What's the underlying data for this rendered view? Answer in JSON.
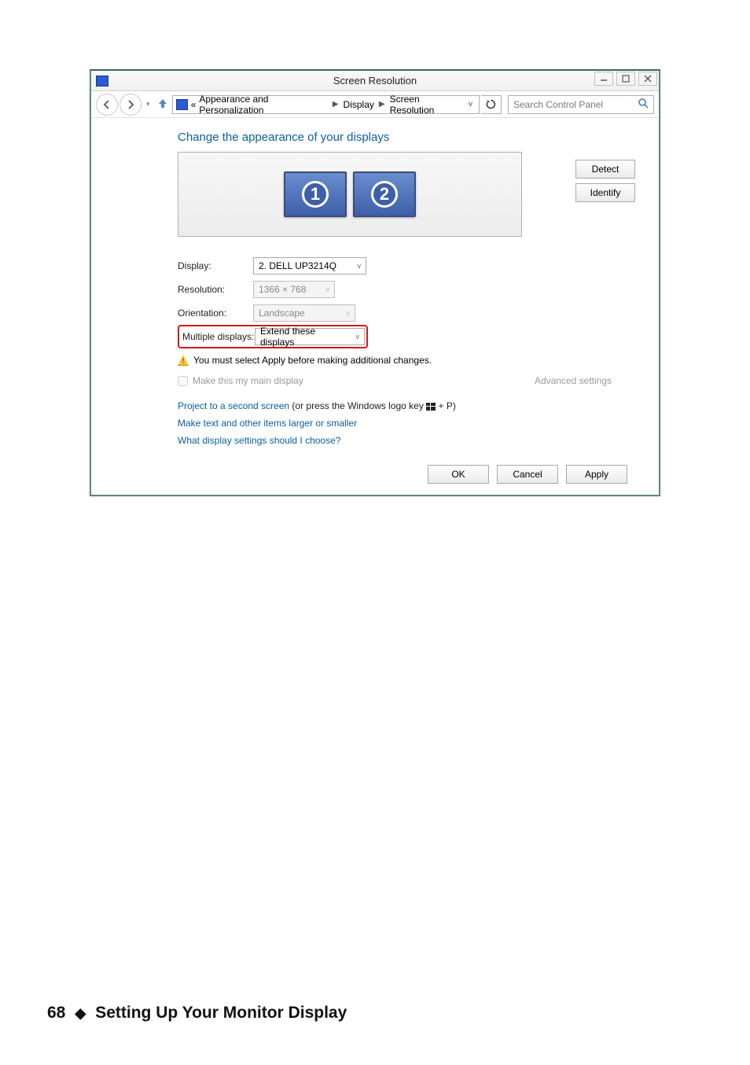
{
  "window": {
    "title": "Screen Resolution",
    "breadcrumb": {
      "prefix": "«",
      "parts": [
        "Appearance and Personalization",
        "Display",
        "Screen Resolution"
      ]
    },
    "search_placeholder": "Search Control Panel"
  },
  "heading": "Change the appearance of your displays",
  "monitors": {
    "m1": "1",
    "m2": "2"
  },
  "side_buttons": {
    "detect": "Detect",
    "identify": "Identify"
  },
  "settings": {
    "display": {
      "label": "Display:",
      "value": "2. DELL UP3214Q"
    },
    "resolution": {
      "label": "Resolution:",
      "value": "1366 × 768"
    },
    "orientation": {
      "label": "Orientation:",
      "value": "Landscape"
    },
    "multiple": {
      "label": "Multiple displays:",
      "value": "Extend these displays"
    }
  },
  "warning": "You must select Apply before making additional changes.",
  "main_display_checkbox": "Make this my main display",
  "advanced_settings": "Advanced settings",
  "links": {
    "project": {
      "link": "Project to a second screen",
      "suffix_a": " (or press the Windows logo key ",
      "suffix_b": " + P)"
    },
    "textsize": "Make text and other items larger or smaller",
    "help": "What display settings should I choose?"
  },
  "buttons": {
    "ok": "OK",
    "cancel": "Cancel",
    "apply": "Apply"
  },
  "footer": {
    "page_number": "68",
    "section_title": "Setting Up Your Monitor Display"
  }
}
